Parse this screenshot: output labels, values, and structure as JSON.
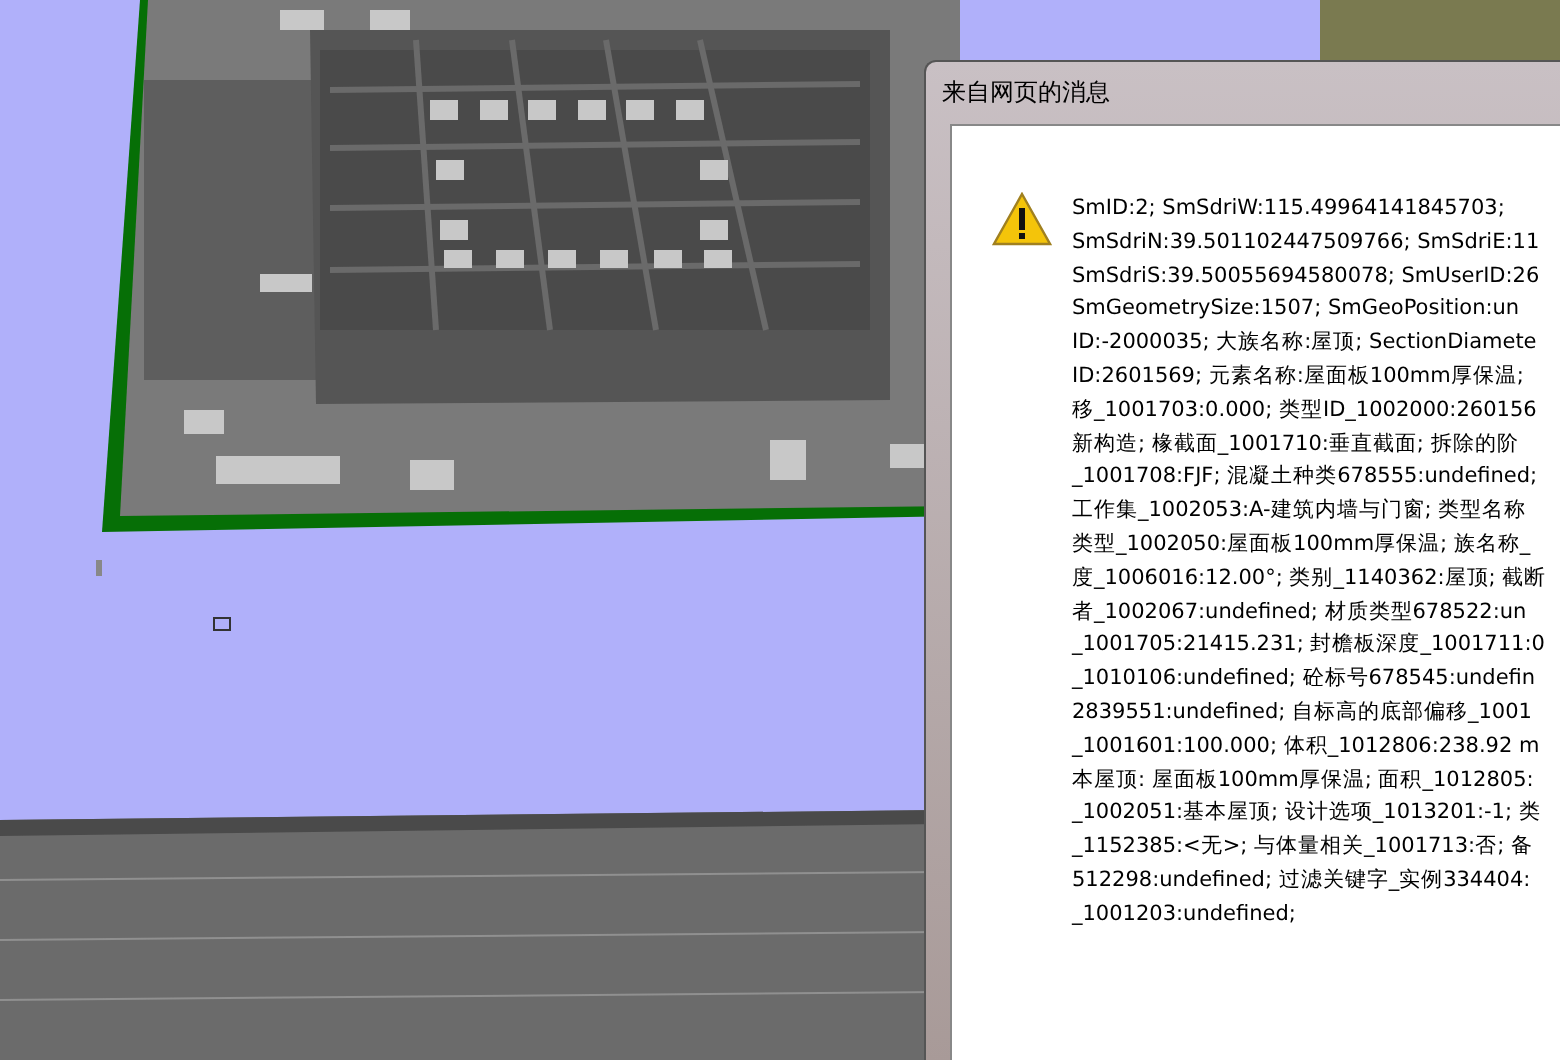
{
  "dialog": {
    "title": "来自网页的消息",
    "message_lines": [
      "SmID:2; SmSdriW:115.49964141845703;",
      "SmSdriN:39.501102447509766; SmSdriE:11",
      "SmSdriS:39.50055694580078; SmUserID:26",
      "SmGeometrySize:1507; SmGeoPosition:un",
      "ID:-2000035; 大族名称:屋顶; SectionDiamete",
      "ID:2601569; 元素名称:屋面板100mm厚保温;",
      "移_1001703:0.000; 类型ID_1002000:260156",
      "新构造; 椽截面_1001710:垂直截面; 拆除的阶",
      "_1001708:FJF; 混凝土种类678555:undefined;",
      "工作集_1002053:A-建筑内墙与门窗; 类型名称",
      "类型_1002050:屋面板100mm厚保温; 族名称_",
      "度_1006016:12.00°; 类别_1140362:屋顶; 截断",
      "者_1002067:undefined; 材质类型678522:un",
      "_1001705:21415.231; 封檐板深度_1001711:0",
      "_1010106:undefined; 砼标号678545:undefin",
      "2839551:undefined; 自标高的底部偏移_1001",
      "_1001601:100.000; 体积_1012806:238.92 m",
      "本屋顶: 屋面板100mm厚保温; 面积_1012805:",
      "_1002051:基本屋顶; 设计选项_1013201:-1; 类",
      "_1152385:<无>; 与体量相关_1001713:否; 备",
      "512298:undefined; 过滤关键字_实例334404:",
      "_1001203:undefined;"
    ]
  }
}
